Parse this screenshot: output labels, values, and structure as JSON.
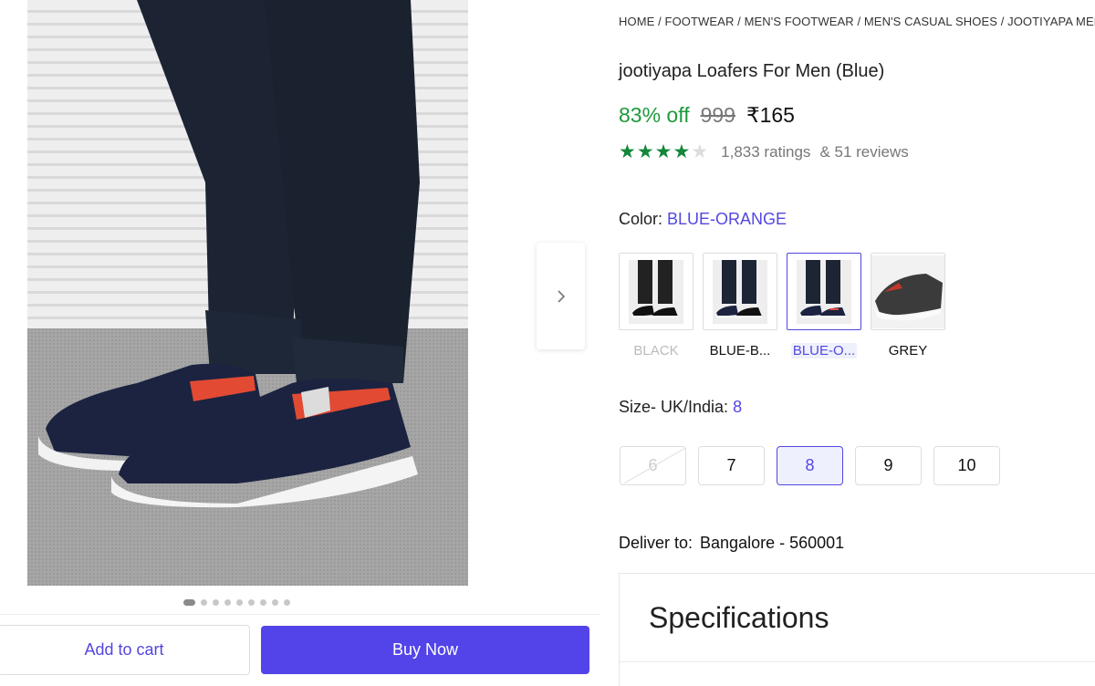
{
  "breadcrumb": "HOME / FOOTWEAR / MEN'S FOOTWEAR / MEN'S CASUAL SHOES / JOOTIYAPA MEN'S",
  "product": {
    "title": "jootiyapa Loafers For Men (Blue)",
    "discount": "83% off",
    "mrp": "999",
    "price": "₹165",
    "rating_value": 4,
    "ratings": "1,833 ratings",
    "reviews": "& 51 reviews"
  },
  "colors": {
    "label": "Color:",
    "selected": "BLUE-ORANGE",
    "options": [
      {
        "label": "BLACK",
        "state": "unavailable"
      },
      {
        "label": "BLUE-B...",
        "state": "available"
      },
      {
        "label": "BLUE-O...",
        "state": "selected"
      },
      {
        "label": "GREY",
        "state": "available"
      }
    ]
  },
  "sizes": {
    "label": "Size- UK/India:",
    "selected": "8",
    "options": [
      {
        "label": "6",
        "state": "unavailable"
      },
      {
        "label": "7",
        "state": "available"
      },
      {
        "label": "8",
        "state": "selected"
      },
      {
        "label": "9",
        "state": "available"
      },
      {
        "label": "10",
        "state": "available"
      }
    ]
  },
  "delivery": {
    "label": "Deliver to:",
    "place": "Bangalore - 560001"
  },
  "specifications": {
    "title": "Specifications"
  },
  "gallery": {
    "image_count": 9,
    "active_index": 0,
    "next_icon": "chevron-right-icon"
  },
  "actions": {
    "add_to_cart": "Add to cart",
    "buy_now": "Buy Now"
  },
  "theme": {
    "accent": "#5344ea",
    "discount": "#1f9a3b",
    "star": "#13873a"
  }
}
